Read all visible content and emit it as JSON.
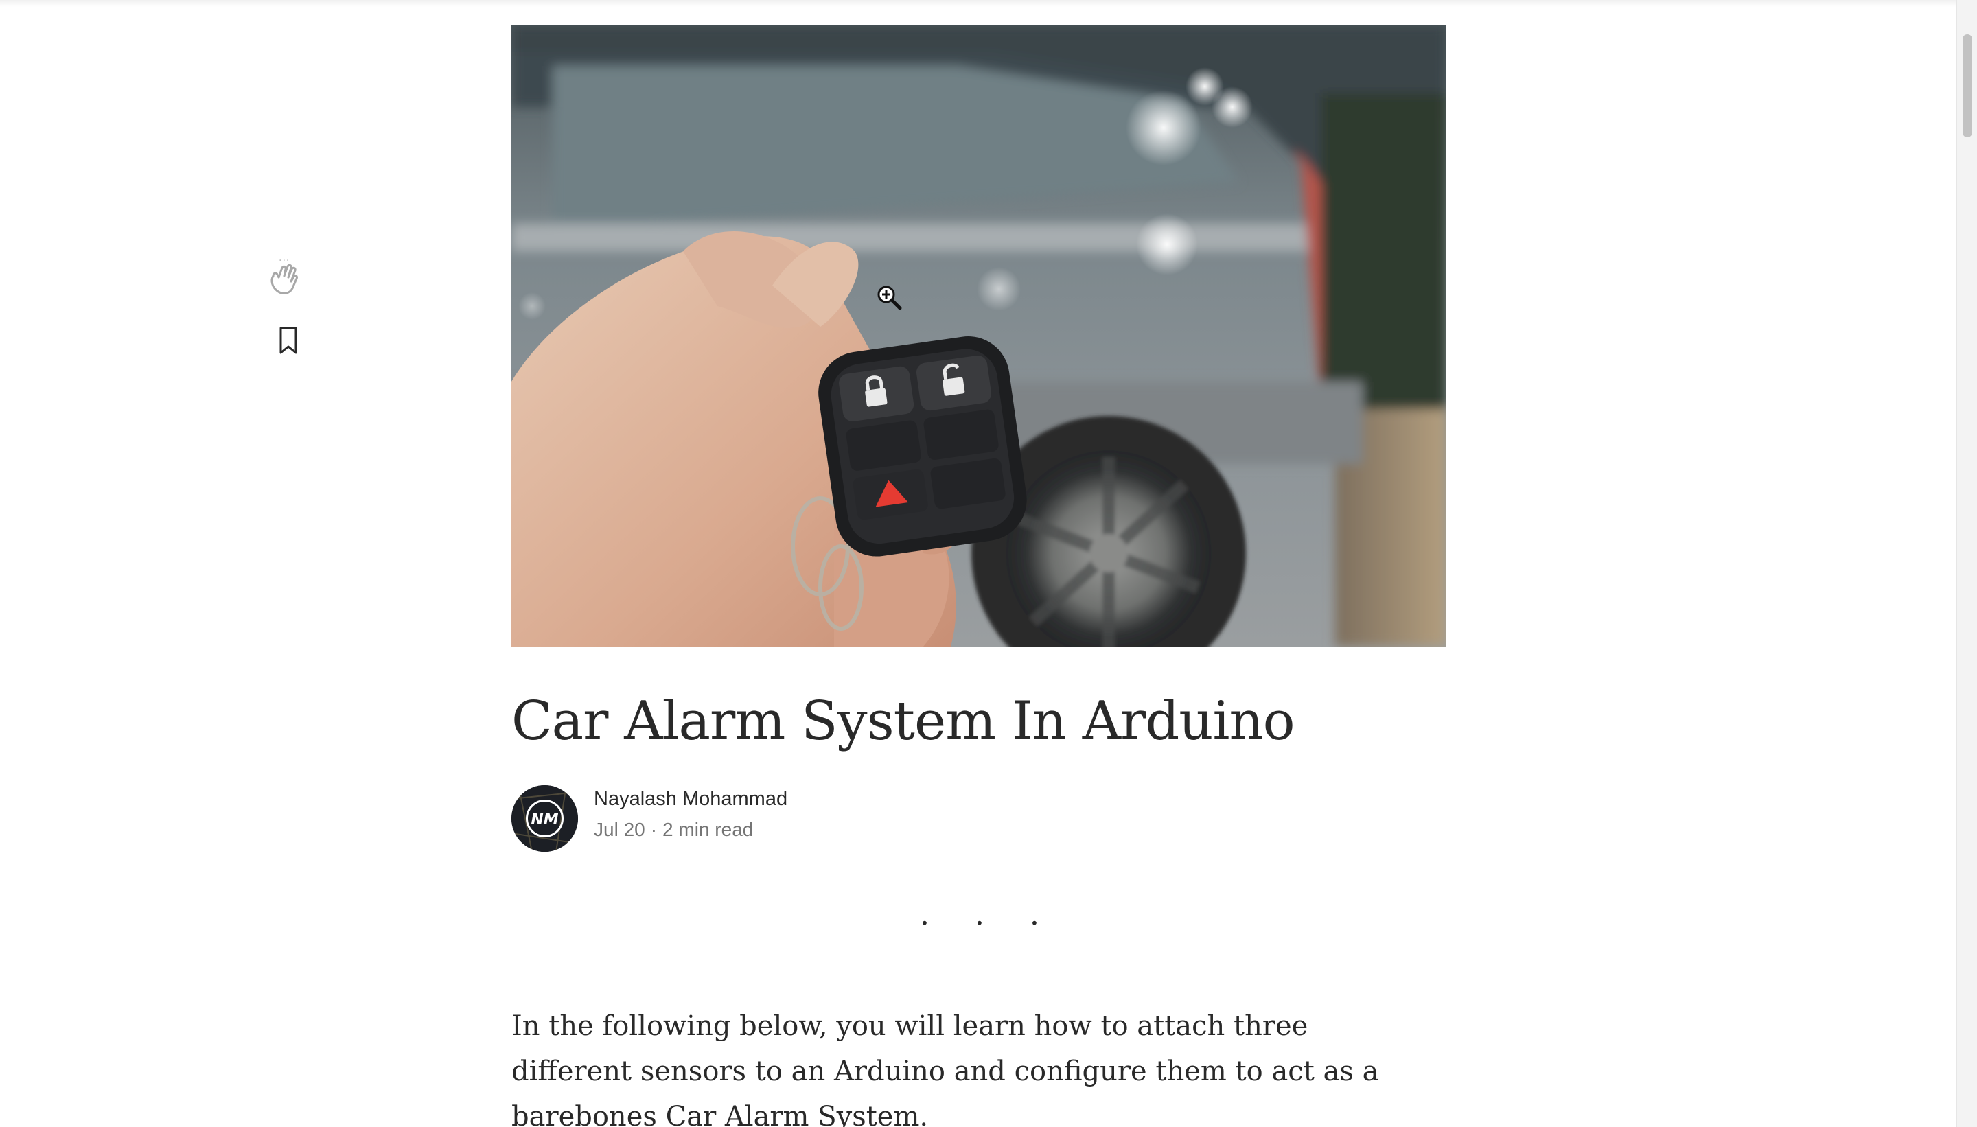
{
  "article": {
    "title": "Car Alarm System In Arduino",
    "author": {
      "name": "Nayalash Mohammad",
      "avatar_initials": "NM"
    },
    "date": "Jul 20",
    "meta_separator": "·",
    "read_time": "2 min read",
    "section_separator": "· · ·",
    "body": [
      "In the following below, you will learn how to attach three different sensors to an Arduino and configure them to act as a barebones Car Alarm System."
    ]
  },
  "actions": {
    "clap_icon": "clap-icon",
    "bookmark_icon": "bookmark-icon"
  },
  "hero_image": {
    "subject": "hand holding car key fob with lock and unlock buttons, grey car in background",
    "cursor_icon": "zoom-in-icon"
  },
  "colors": {
    "text_primary": "#292929",
    "text_secondary": "#757575",
    "background": "#ffffff",
    "icon_grey": "#bbbbbb"
  }
}
